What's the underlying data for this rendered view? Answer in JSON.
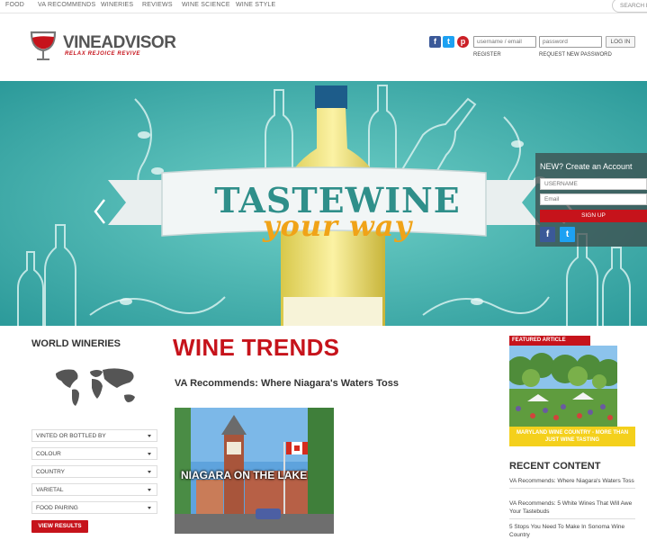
{
  "topnav": {
    "items": [
      "FOOD",
      "VA RECOMMENDS",
      "WINERIES",
      "REVIEWS",
      "WINE SCIENCE",
      "WINE STYLE"
    ],
    "search_label": "SEARCH BY"
  },
  "brand": {
    "name": "VINEADVISOR",
    "tagline": "RELAX REJOICE REVIVE"
  },
  "login": {
    "username_placeholder": "username / email",
    "password_placeholder": "password",
    "button": "LOG IN",
    "register": "REGISTER",
    "request_password": "REQUEST NEW PASSWORD"
  },
  "hero": {
    "title": "TASTEWINE",
    "subtitle": "your way"
  },
  "signup": {
    "title": "NEW? Create an Account",
    "username_placeholder": "USERNAME",
    "email_placeholder": "Email",
    "button": "SIGN UP"
  },
  "sidebar": {
    "heading": "WORLD WINERIES",
    "filters": [
      "VINTED OR BOTTLED BY",
      "COLOUR",
      "COUNTRY",
      "VARIETAL",
      "FOOD PAIRING"
    ],
    "view_button": "VIEW RESULTS"
  },
  "main": {
    "heading": "WINE TRENDS",
    "article_title": "VA Recommends: Where Niagara's Waters Toss",
    "image_caption": "NIAGARA ON THE LAKE"
  },
  "featured": {
    "label": "FEATURED ARTICLE",
    "caption": "MARYLAND WINE COUNTRY - MORE THAN JUST WINE TASTING"
  },
  "recent": {
    "heading": "RECENT CONTENT",
    "items": [
      "VA Recommends: Where Niagara's Waters Toss",
      "VA Recommends: 5 White Wines That Will Awe Your Tastebuds",
      "5 Stops You Need To Make In Sonoma Wine Country"
    ]
  },
  "colors": {
    "brand_red": "#c6131b",
    "hero_teal": "#48b5b1",
    "facebook": "#3b5998",
    "twitter": "#1da1f2",
    "pinterest": "#cb2027",
    "featured_yellow": "#f4d01c"
  },
  "icons": [
    "facebook-icon",
    "twitter-icon",
    "pinterest-icon",
    "world-map-icon",
    "chevron-left-icon",
    "chevron-right-icon",
    "caret-down-icon"
  ]
}
